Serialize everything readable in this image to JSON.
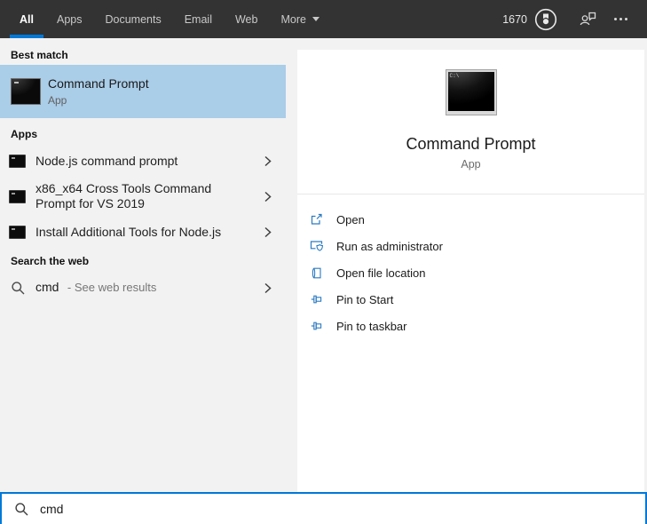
{
  "topbar": {
    "tabs": [
      {
        "label": "All",
        "selected": true
      },
      {
        "label": "Apps",
        "selected": false
      },
      {
        "label": "Documents",
        "selected": false
      },
      {
        "label": "Email",
        "selected": false
      },
      {
        "label": "Web",
        "selected": false
      },
      {
        "label": "More",
        "selected": false,
        "has_menu": true
      }
    ],
    "rewards_points": "1670"
  },
  "left": {
    "best_match_header": "Best match",
    "best_match": {
      "title": "Command Prompt",
      "subtitle": "App"
    },
    "apps_header": "Apps",
    "apps": [
      {
        "title": "Node.js command prompt"
      },
      {
        "title": "x86_x64 Cross Tools Command Prompt for VS 2019"
      },
      {
        "title": "Install Additional Tools for Node.js"
      }
    ],
    "web_header": "Search the web",
    "web": {
      "query": "cmd",
      "hint": "- See web results"
    }
  },
  "right": {
    "title": "Command Prompt",
    "subtitle": "App",
    "icon_text": "C:\\",
    "actions": [
      {
        "label": "Open",
        "icon": "open-window-icon"
      },
      {
        "label": "Run as administrator",
        "icon": "admin-shield-icon"
      },
      {
        "label": "Open file location",
        "icon": "file-location-icon"
      },
      {
        "label": "Pin to Start",
        "icon": "pin-icon"
      },
      {
        "label": "Pin to taskbar",
        "icon": "pin-icon"
      }
    ]
  },
  "search": {
    "value": "cmd"
  },
  "icons": {
    "search": "magnifier",
    "rewards-medal": "medal-in-circle",
    "account": "person-with-speech-bubble",
    "more-options": "ellipsis-dots",
    "dropdown-arrow": "caret-down",
    "chevron-right": "angle-bracket",
    "terminal": "black-command-window",
    "open-window": "window-with-launch-arrow",
    "admin-shield": "window-with-shield",
    "file-location": "page-with-curl",
    "pin": "pushpin-horizontal"
  },
  "colors": {
    "accent": "#0078d7",
    "topbar_bg": "#333333",
    "panel_bg": "#f2f2f2",
    "highlight": "#aacde8",
    "action_icon_blue": "#2a7ac2"
  }
}
